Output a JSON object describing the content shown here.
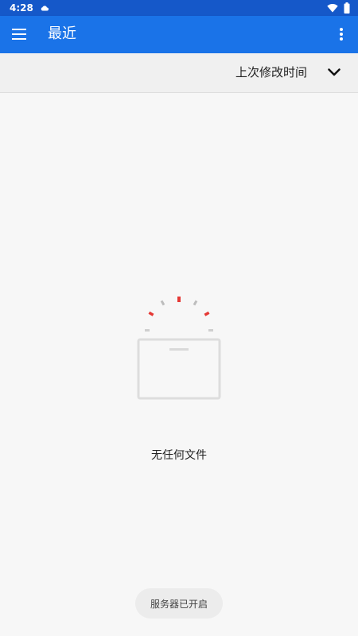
{
  "status_bar": {
    "time": "4:28",
    "icons": [
      "cloud-icon",
      "wifi-icon",
      "battery-icon"
    ]
  },
  "app_bar": {
    "title": "最近",
    "menu_icon": "hamburger-menu-icon",
    "more_icon": "more-vert-icon",
    "color": "#1a73e8"
  },
  "sort": {
    "label": "上次修改时间",
    "toggle_icon": "chevron-down-icon"
  },
  "empty_state": {
    "message": "无任何文件",
    "illustration": "empty-box-icon",
    "accent_color": "#e53935"
  },
  "toast": {
    "text": "服务器已开启"
  }
}
